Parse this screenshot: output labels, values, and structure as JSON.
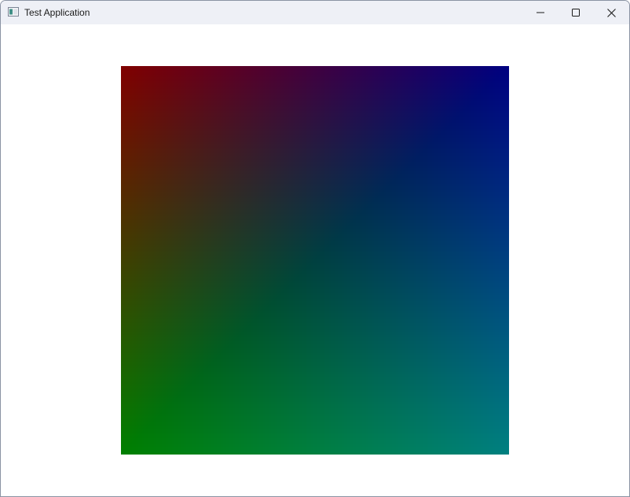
{
  "window": {
    "title": "Test Application",
    "icon": "app-window-icon"
  },
  "caption_buttons": {
    "minimize_icon": "minimize-icon",
    "maximize_icon": "maximize-icon",
    "close_icon": "close-icon"
  },
  "canvas": {
    "content": "color-gradient-quad",
    "corner_colors": {
      "top_left": "#800000",
      "top_right": "#000080",
      "bottom_left": "#008000",
      "bottom_right": "#008080"
    },
    "center_color": "#404040"
  }
}
